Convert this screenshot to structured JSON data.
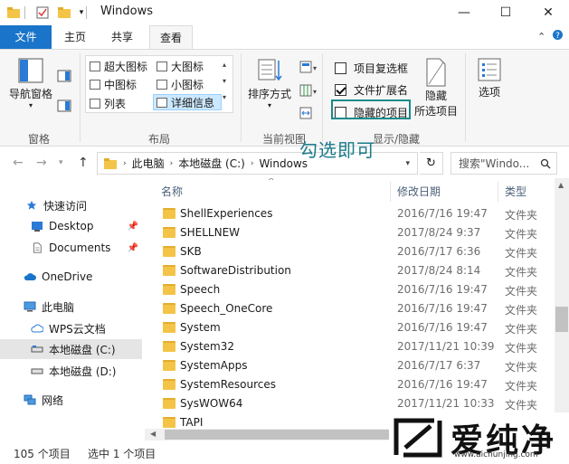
{
  "window": {
    "title": "Windows",
    "minimize": "—",
    "maximize": "☐",
    "close": "✕"
  },
  "tabs": {
    "file": "文件",
    "home": "主页",
    "share": "共享",
    "view": "查看"
  },
  "ribbon": {
    "panes": {
      "nav_pane_label": "导航窗格",
      "group_label": "窗格"
    },
    "layout": {
      "group_label": "布局",
      "items": [
        "超大图标",
        "大图标",
        "中图标",
        "小图标",
        "列表",
        "详细信息"
      ],
      "selected": "详细信息"
    },
    "current_view": {
      "sort_label": "排序方式",
      "group_label": "当前视图"
    },
    "show_hide": {
      "item_checkboxes": "项目复选框",
      "item_checkboxes_checked": false,
      "file_extensions": "文件扩展名",
      "file_extensions_checked": true,
      "hidden_items": "隐藏的项目",
      "hidden_items_checked": false,
      "hide_selected_line1": "隐藏",
      "hide_selected_line2": "所选项目",
      "group_label": "显示/隐藏"
    },
    "options_label": "选项"
  },
  "annotation": "勾选即可",
  "address": {
    "path": [
      "此电脑",
      "本地磁盘 (C:)",
      "Windows"
    ],
    "search_placeholder": "搜索\"Windo..."
  },
  "nav_pane": {
    "items": [
      {
        "label": "快速访问",
        "icon": "star-icon"
      },
      {
        "label": "Desktop",
        "icon": "desktop-icon",
        "pinned": true
      },
      {
        "label": "Documents",
        "icon": "documents-icon",
        "pinned": true
      },
      {
        "label": "OneDrive",
        "icon": "cloud-icon"
      },
      {
        "label": "此电脑",
        "icon": "computer-icon"
      },
      {
        "label": "WPS云文档",
        "icon": "cloud-outline-icon"
      },
      {
        "label": "本地磁盘 (C:)",
        "icon": "drive-icon",
        "selected": true
      },
      {
        "label": "本地磁盘 (D:)",
        "icon": "drive-icon"
      },
      {
        "label": "网络",
        "icon": "network-icon"
      }
    ]
  },
  "file_list": {
    "columns": {
      "name": "名称",
      "date": "修改日期",
      "type": "类型"
    },
    "rows": [
      {
        "name": "ShellExperiences",
        "date": "2016/7/16 19:47",
        "type": "文件夹"
      },
      {
        "name": "SHELLNEW",
        "date": "2017/8/24 9:37",
        "type": "文件夹"
      },
      {
        "name": "SKB",
        "date": "2016/7/17 6:36",
        "type": "文件夹"
      },
      {
        "name": "SoftwareDistribution",
        "date": "2017/8/24 8:14",
        "type": "文件夹"
      },
      {
        "name": "Speech",
        "date": "2016/7/16 19:47",
        "type": "文件夹"
      },
      {
        "name": "Speech_OneCore",
        "date": "2016/7/16 19:47",
        "type": "文件夹"
      },
      {
        "name": "System",
        "date": "2016/7/16 19:47",
        "type": "文件夹"
      },
      {
        "name": "System32",
        "date": "2017/11/21 10:39",
        "type": "文件夹"
      },
      {
        "name": "SystemApps",
        "date": "2016/7/17 6:37",
        "type": "文件夹"
      },
      {
        "name": "SystemResources",
        "date": "2016/7/16 19:47",
        "type": "文件夹"
      },
      {
        "name": "SysWOW64",
        "date": "2017/11/21 10:33",
        "type": "文件夹"
      },
      {
        "name": "TAPI",
        "date": "",
        "type": ""
      }
    ]
  },
  "status": {
    "count": "105 个项目",
    "selected": "选中 1 个项目"
  },
  "watermark": {
    "brand": "爱纯净",
    "url": "www.aichunjing.com"
  }
}
